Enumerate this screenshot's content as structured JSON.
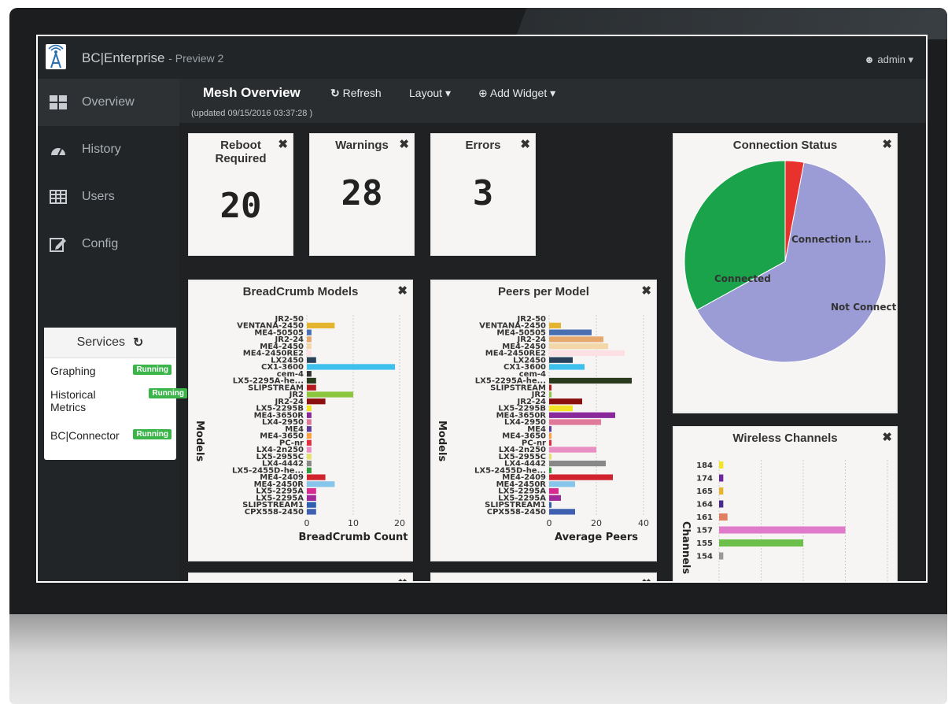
{
  "app": {
    "brand": "BC|Enterprise",
    "brand_sub": "- Preview 2",
    "user": "admin"
  },
  "sidebar": {
    "items": [
      {
        "label": "Overview",
        "icon": "dashboard-icon"
      },
      {
        "label": "History",
        "icon": "gauge-icon"
      },
      {
        "label": "Users",
        "icon": "table-icon"
      },
      {
        "label": "Config",
        "icon": "edit-icon"
      }
    ]
  },
  "services": {
    "title": "Services",
    "items": [
      {
        "name": "Graphing",
        "status": "Running"
      },
      {
        "name": "Historical Metrics",
        "status": "Running"
      },
      {
        "name": "BC|Connector",
        "status": "Running"
      }
    ]
  },
  "header": {
    "title": "Mesh Overview",
    "refresh": "Refresh",
    "layout": "Layout",
    "add_widget": "Add Widget",
    "updated": "(updated 09/15/2016 03:37:28 )"
  },
  "stats": [
    {
      "title": "Reboot Required",
      "value": "20"
    },
    {
      "title": "Warnings",
      "value": "28"
    },
    {
      "title": "Errors",
      "value": "3"
    }
  ],
  "chart_data": [
    {
      "type": "bar",
      "title": "BreadCrumb Models",
      "xlabel": "BreadCrumb Count",
      "ylabel": "Models",
      "xlim": [
        0,
        20
      ],
      "xticks": [
        0,
        10,
        20
      ],
      "categories": [
        "JR2-50",
        "VENTANA-2450",
        "ME4-50505",
        "JR2-24",
        "ME4-2450",
        "ME4-2450RE2",
        "LX2450",
        "CX1-3600",
        "cem-4",
        "LX5-2295A-he...",
        "SLIPSTREAM",
        "JR2",
        "JR2-24",
        "LX5-2295B",
        "ME4-3650R",
        "LX4-2950",
        "ME4",
        "ME4-3650",
        "PC-nr",
        "LX4-2n250",
        "LX5-2955C",
        "LX4-4442",
        "LX5-2455D-he...",
        "ME4-2409",
        "ME4-2450R",
        "LX5-2295A",
        "LX5-2295A",
        "SLIPSTREAM1",
        "CPX558-2450"
      ],
      "values": [
        0,
        6,
        1,
        1,
        1,
        1,
        2,
        19,
        1,
        2,
        2,
        10,
        4,
        1,
        1,
        1,
        1,
        1,
        1,
        1,
        1,
        1,
        1,
        4,
        6,
        2,
        2,
        2,
        2
      ]
    },
    {
      "type": "bar",
      "title": "Peers per Model",
      "xlabel": "Average Peers",
      "ylabel": "Models",
      "xlim": [
        0,
        40
      ],
      "xticks": [
        0,
        20,
        40
      ],
      "categories": [
        "JR2-50",
        "VENTANA-2450",
        "ME4-50505",
        "JR2-24",
        "ME4-2450",
        "ME4-2450RE2",
        "LX2450",
        "CX1-3600",
        "cem-4",
        "LX5-2295A-he...",
        "SLIPSTREAM",
        "JR2",
        "JR2-24",
        "LX5-2295B",
        "ME4-3650R",
        "LX4-2950",
        "ME4",
        "ME4-3650",
        "PC-nr",
        "LX4-2n250",
        "LX5-2955C",
        "LX4-4442",
        "LX5-2455D-he...",
        "ME4-2409",
        "ME4-2450R",
        "LX5-2295A",
        "LX5-2295A",
        "SLIPSTREAM1",
        "CPX558-2450"
      ],
      "values": [
        0,
        5,
        18,
        23,
        25,
        32,
        10,
        15,
        0,
        35,
        1,
        1,
        14,
        10,
        28,
        22,
        1,
        1,
        1,
        20,
        1,
        24,
        1,
        27,
        11,
        4,
        5,
        1,
        11
      ]
    },
    {
      "type": "pie",
      "title": "Connection Status",
      "labels": [
        "Not Connecte...",
        "Connected",
        "Connection L..."
      ],
      "values": [
        64,
        33,
        3
      ]
    },
    {
      "type": "bar",
      "title": "Wireless Channels",
      "ylabel": "Channels",
      "categories": [
        "184",
        "174",
        "165",
        "164",
        "161",
        "157",
        "155",
        "154"
      ],
      "values": [
        1,
        1,
        1,
        1,
        2,
        30,
        20,
        1
      ]
    }
  ],
  "colors": {
    "accent_green": "#3bb54a",
    "pie_blue": "#9b9cd6",
    "pie_green": "#1aa34a",
    "pie_red": "#e8322e"
  }
}
